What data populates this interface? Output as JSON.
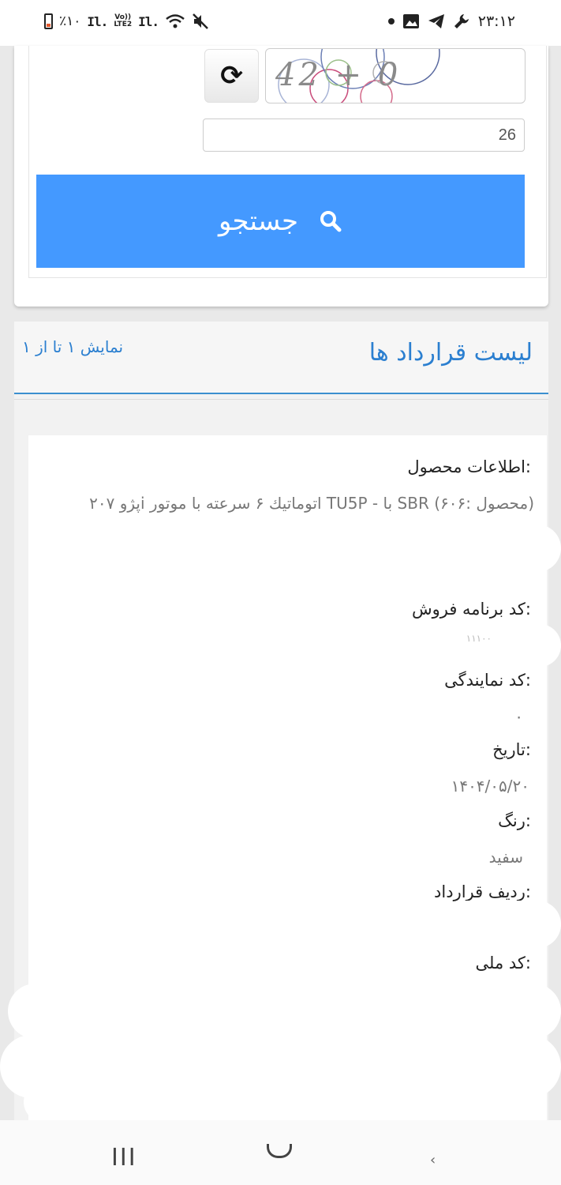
{
  "status_bar": {
    "battery_text": "٪۱۰",
    "signal_1": "Il.",
    "volte_top": "Vo))",
    "volte_bottom": "LTE2",
    "signal_2": "Il.",
    "time": "۲۳:۱۲"
  },
  "search": {
    "captcha_text": "42 + 0",
    "captcha_answer": "26",
    "refresh_icon": "⟳",
    "search_button_label": "جستجو",
    "search_icon": "🔍"
  },
  "list": {
    "title": "لیست قرارداد ها",
    "count_text": "نمایش ۱ تا از ۱",
    "item": {
      "product_label": "اطلاعات محصول:",
      "product_value": "پژو ۲۰۷i اتوماتیك ۶ سرعته با موتور TU5P - با SBR (محصول :۶۰۶)",
      "sale_code_label": "کد برنامه فروش:",
      "sale_code_value": "۱۱۱۰۰",
      "agent_code_label": "کد نمایندگی:",
      "agent_code_value": "۰",
      "date_label": "تاریخ:",
      "date_value": "۱۴۰۴/۰۵/۲۰",
      "color_label": "رنگ:",
      "color_value": "سفید",
      "contract_row_label": "ردیف قرارداد:",
      "national_code_label": "کد ملی:"
    }
  },
  "nav": {
    "recent_icon": "recent-apps-icon",
    "home_icon": "home-icon",
    "back_icon": "back-icon",
    "recent_glyph": "III"
  }
}
